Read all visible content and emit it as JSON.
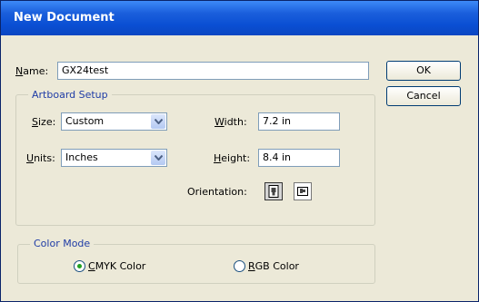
{
  "window": {
    "title": "New Document"
  },
  "name_field": {
    "label_prefix": "",
    "label_underlined": "N",
    "label_rest": "ame:",
    "value": "GX24test"
  },
  "buttons": {
    "ok": "OK",
    "cancel": "Cancel"
  },
  "artboard": {
    "legend": "Artboard Setup",
    "size": {
      "label_underlined": "S",
      "label_rest": "ize:",
      "value": "Custom"
    },
    "units": {
      "label_underlined": "U",
      "label_rest": "nits:",
      "value": "Inches"
    },
    "width": {
      "label_underlined": "W",
      "label_rest": "idth:",
      "value": "7.2 in"
    },
    "height": {
      "label_underlined": "H",
      "label_rest": "eight:",
      "value": "8.4 in"
    },
    "orientation": {
      "label": "Orientation:"
    }
  },
  "color_mode": {
    "legend": "Color Mode",
    "cmyk": {
      "label_underlined": "C",
      "label_rest": "MYK Color",
      "checked": true
    },
    "rgb": {
      "label_underlined": "R",
      "label_rest": "GB Color",
      "checked": false
    }
  }
}
